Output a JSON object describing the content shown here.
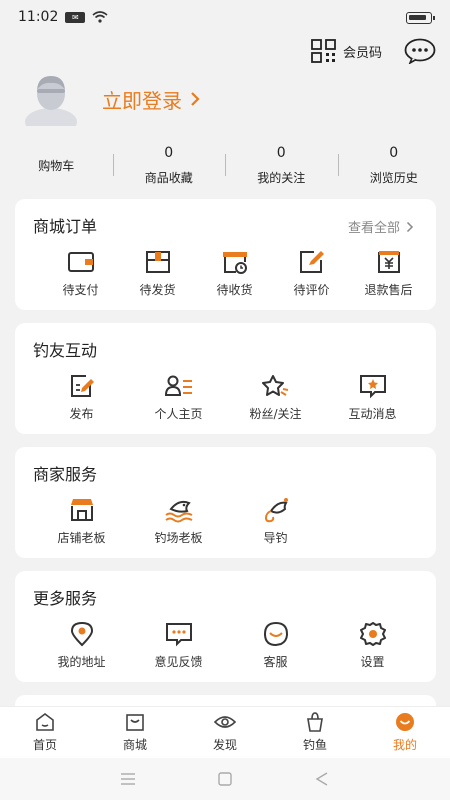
{
  "status": {
    "time": "11:02",
    "sim": "SIM"
  },
  "header": {
    "vip_code": "会员码"
  },
  "profile": {
    "login": "立即登录"
  },
  "stats": [
    {
      "num": "",
      "label": "购物车"
    },
    {
      "num": "0",
      "label": "商品收藏"
    },
    {
      "num": "0",
      "label": "我的关注"
    },
    {
      "num": "0",
      "label": "浏览历史"
    }
  ],
  "orders": {
    "title": "商城订单",
    "more": "查看全部",
    "items": [
      {
        "label": "待支付",
        "icon": "wallet-icon"
      },
      {
        "label": "待发货",
        "icon": "package-icon"
      },
      {
        "label": "待收货",
        "icon": "delivery-icon"
      },
      {
        "label": "待评价",
        "icon": "review-icon"
      },
      {
        "label": "退款售后",
        "icon": "refund-icon"
      }
    ]
  },
  "community": {
    "title": "钓友互动",
    "items": [
      {
        "label": "发布",
        "icon": "post-icon"
      },
      {
        "label": "个人主页",
        "icon": "profile-icon"
      },
      {
        "label": "粉丝/关注",
        "icon": "fans-icon"
      },
      {
        "label": "互动消息",
        "icon": "message-icon"
      }
    ]
  },
  "merchant": {
    "title": "商家服务",
    "items": [
      {
        "label": "店铺老板",
        "icon": "shop-icon"
      },
      {
        "label": "钓场老板",
        "icon": "fishing-ground-icon"
      },
      {
        "label": "导钓",
        "icon": "fishing-guide-icon"
      }
    ]
  },
  "more_services": {
    "title": "更多服务",
    "items": [
      {
        "label": "我的地址",
        "icon": "location-icon"
      },
      {
        "label": "意见反馈",
        "icon": "feedback-icon"
      },
      {
        "label": "客服",
        "icon": "customer-service-icon"
      },
      {
        "label": "设置",
        "icon": "settings-icon"
      }
    ]
  },
  "tabs": [
    {
      "label": "首页",
      "icon": "home-icon"
    },
    {
      "label": "商城",
      "icon": "mall-icon"
    },
    {
      "label": "发现",
      "icon": "discover-icon"
    },
    {
      "label": "钓鱼",
      "icon": "fishing-icon"
    },
    {
      "label": "我的",
      "icon": "mine-icon",
      "active": true
    }
  ],
  "colors": {
    "accent": "#e87c1e",
    "background": "#f2f2f2",
    "card": "#ffffff"
  }
}
